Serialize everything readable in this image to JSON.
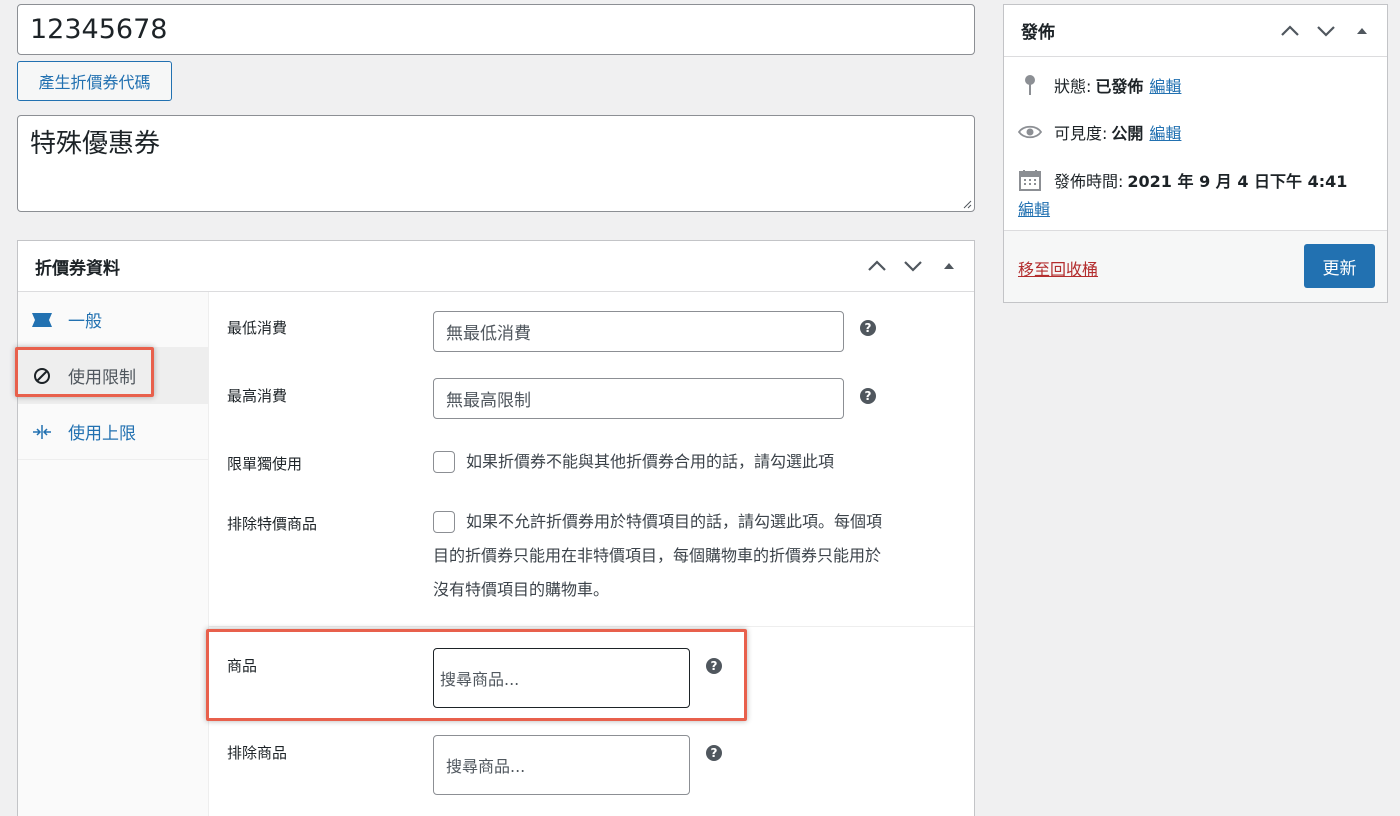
{
  "coupon": {
    "code_value": "12345678",
    "generate_label": "產生折價券代碼",
    "description_value": "特殊優惠券"
  },
  "coupon_data": {
    "title": "折價券資料",
    "tabs": [
      {
        "label": "一般",
        "icon": "ticket-icon"
      },
      {
        "label": "使用限制",
        "icon": "no-entry-icon"
      },
      {
        "label": "使用上限",
        "icon": "limit-arrows-icon"
      }
    ],
    "fields": {
      "min_spend_label": "最低消費",
      "min_spend_placeholder": "無最低消費",
      "max_spend_label": "最高消費",
      "max_spend_placeholder": "無最高限制",
      "individual_label": "限單獨使用",
      "individual_text": "如果折價券不能與其他折價券合用的話，請勾選此項",
      "exclude_sale_label": "排除特價商品",
      "exclude_sale_line1": "如果不允許折價券用於特價項目的話，請勾選此項。每個項",
      "exclude_sale_line2": "目的折價券只能用在非特價項目，每個購物車的折價券只能用於",
      "exclude_sale_line3": "沒有特價項目的購物車。",
      "products_label": "商品",
      "products_placeholder": "搜尋商品...",
      "exclude_products_label": "排除商品",
      "exclude_products_placeholder": "搜尋商品..."
    }
  },
  "publish": {
    "title": "發佈",
    "status_label": "狀態:",
    "status_value": "已發佈",
    "visibility_label": "可見度:",
    "visibility_value": "公開",
    "published_label": "發佈時間:",
    "published_value": "2021 年 9 月 4 日下午 4:41",
    "edit_label": "編輯",
    "trash_label": "移至回收桶",
    "update_label": "更新"
  },
  "colors": {
    "accent": "#2271b1",
    "highlight": "#e8604c",
    "trash": "#b32d2e"
  }
}
